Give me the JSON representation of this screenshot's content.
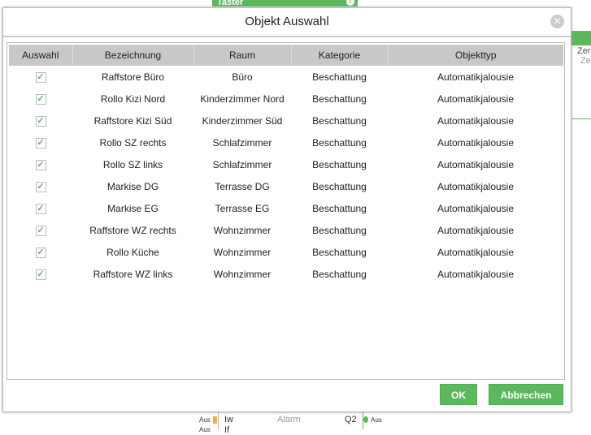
{
  "background": {
    "taster": "Taster",
    "right_texts": [
      "Zer",
      "Ze"
    ],
    "bottom": {
      "in1": "Aus",
      "in1_label": "Iw",
      "in2": "Aus",
      "in2_label": "If",
      "alarm": "Alarm",
      "q2": "Q2",
      "out": "Aus"
    }
  },
  "dialog": {
    "title": "Objekt Auswahl",
    "columns": [
      "Auswahl",
      "Bezeichnung",
      "Raum",
      "Kategorie",
      "Objekttyp"
    ],
    "rows": [
      {
        "checked": true,
        "name": "Raffstore Büro",
        "room": "Büro",
        "category": "Beschattung",
        "type": "Automatikjalousie"
      },
      {
        "checked": true,
        "name": "Rollo Kizi Nord",
        "room": "Kinderzimmer Nord",
        "category": "Beschattung",
        "type": "Automatikjalousie"
      },
      {
        "checked": true,
        "name": "Raffstore Kizi Süd",
        "room": "Kinderzimmer Süd",
        "category": "Beschattung",
        "type": "Automatikjalousie"
      },
      {
        "checked": true,
        "name": "Rollo SZ rechts",
        "room": "Schlafzimmer",
        "category": "Beschattung",
        "type": "Automatikjalousie"
      },
      {
        "checked": true,
        "name": "Rollo SZ links",
        "room": "Schlafzimmer",
        "category": "Beschattung",
        "type": "Automatikjalousie"
      },
      {
        "checked": true,
        "name": "Markise DG",
        "room": "Terrasse DG",
        "category": "Beschattung",
        "type": "Automatikjalousie"
      },
      {
        "checked": true,
        "name": "Markise EG",
        "room": "Terrasse EG",
        "category": "Beschattung",
        "type": "Automatikjalousie"
      },
      {
        "checked": true,
        "name": "Raffstore WZ rechts",
        "room": "Wohnzimmer",
        "category": "Beschattung",
        "type": "Automatikjalousie"
      },
      {
        "checked": true,
        "name": "Rollo Küche",
        "room": "Wohnzimmer",
        "category": "Beschattung",
        "type": "Automatikjalousie"
      },
      {
        "checked": true,
        "name": "Raffstore WZ links",
        "room": "Wohnzimmer",
        "category": "Beschattung",
        "type": "Automatikjalousie"
      }
    ],
    "ok_label": "OK",
    "cancel_label": "Abbrechen"
  },
  "colors": {
    "accent": "#5cb85c"
  }
}
